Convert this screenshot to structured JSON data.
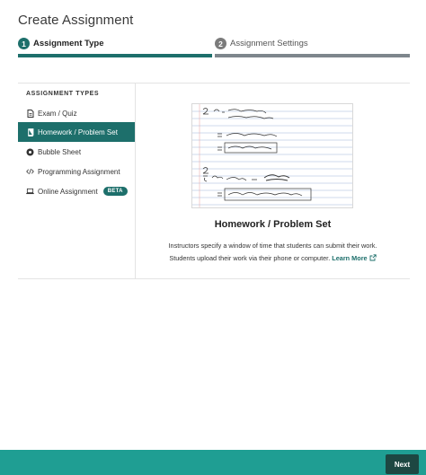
{
  "page": {
    "title": "Create Assignment"
  },
  "steps": [
    {
      "number": "1",
      "label": "Assignment Type",
      "state": "active"
    },
    {
      "number": "2",
      "label": "Assignment Settings",
      "state": "inactive"
    }
  ],
  "sidebar": {
    "heading": "ASSIGNMENT TYPES",
    "items": [
      {
        "label": "Exam / Quiz",
        "icon": "document-icon",
        "active": false
      },
      {
        "label": "Homework / Problem Set",
        "icon": "book-icon",
        "active": true
      },
      {
        "label": "Bubble Sheet",
        "icon": "bubble-icon",
        "active": false
      },
      {
        "label": "Programming Assignment",
        "icon": "code-icon",
        "active": false
      },
      {
        "label": "Online Assignment",
        "icon": "laptop-icon",
        "active": false,
        "badge": "BETA"
      }
    ]
  },
  "detail": {
    "title": "Homework / Problem Set",
    "description_line1": "Instructors specify a window of time that students can submit their work.",
    "description_line2": "Students upload their work via their phone or computer.",
    "learn_more": "Learn More",
    "learn_more_icon": "external-link-icon"
  },
  "footer": {
    "next_label": "Next"
  },
  "colors": {
    "accent": "#1d6f6b",
    "footer": "#1f9e93",
    "next_button": "#1d4742",
    "inactive_bar": "#7e868c"
  }
}
